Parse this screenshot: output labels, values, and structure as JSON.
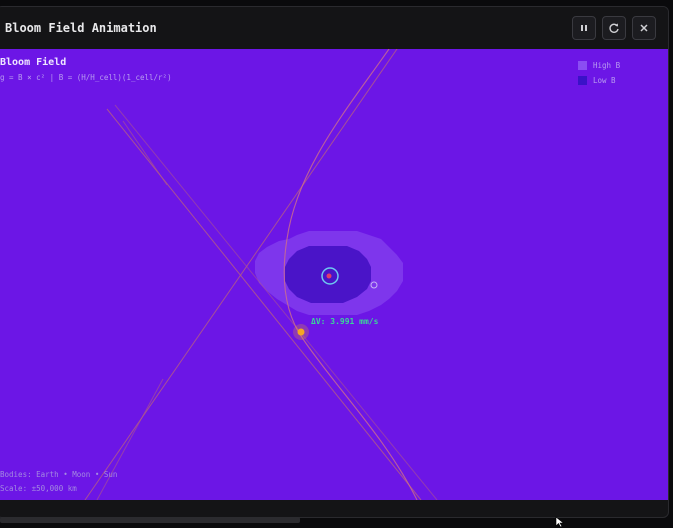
{
  "window": {
    "title": "Bloom Field Animation",
    "buttons": {
      "pause_icon": "pause-icon",
      "restart_icon": "refresh-icon",
      "close_icon": "close-icon"
    }
  },
  "canvas": {
    "title": "Bloom Field",
    "formula": "g = B × c² | B = (H/H_cell)(1_cell/r²)",
    "legend": [
      {
        "label": "High B",
        "color": "#8a4ef2"
      },
      {
        "label": "Low B",
        "color": "#3a12c8"
      }
    ],
    "readout": "ΔV: 3.991 mm/s",
    "footer": {
      "bodies": "Bodies: Earth • Moon • Sun",
      "scale": "Scale: ±50,000 km"
    }
  },
  "colors": {
    "field_background": "#6c16e6",
    "bloom_outer": "#7e36ec",
    "bloom_inner": "#4a14c8",
    "earth": "#e03c6c",
    "earth_ring": "#6ec8f0",
    "sun": "#f5a623",
    "trajectory": "#c06080",
    "readout": "#3cd39a"
  }
}
